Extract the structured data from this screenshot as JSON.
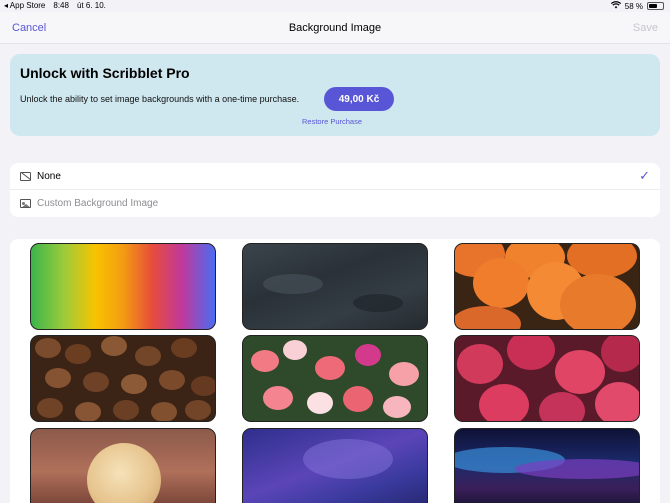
{
  "status_bar": {
    "back_app": "◂ App Store",
    "time": "8:48",
    "date": "út 6. 10.",
    "battery": "58 %"
  },
  "nav": {
    "cancel": "Cancel",
    "title": "Background Image",
    "save": "Save"
  },
  "pro": {
    "title": "Unlock with Scribblet Pro",
    "description": "Unlock the ability to set image backgrounds with a one-time purchase.",
    "price": "49,00 Kč",
    "restore": "Restore Purchase"
  },
  "options": {
    "none_label": "None",
    "custom_label": "Custom Background Image",
    "selected": "None",
    "accent_color": "#5856d6"
  },
  "gallery": {
    "tiles": [
      "rainbow-gradient",
      "dark-slate-texture",
      "pumpkins",
      "coffee-beans",
      "pink-flowers",
      "red-chrysanthemums",
      "full-moon",
      "galaxy-night-sky",
      "neon-wave"
    ]
  }
}
